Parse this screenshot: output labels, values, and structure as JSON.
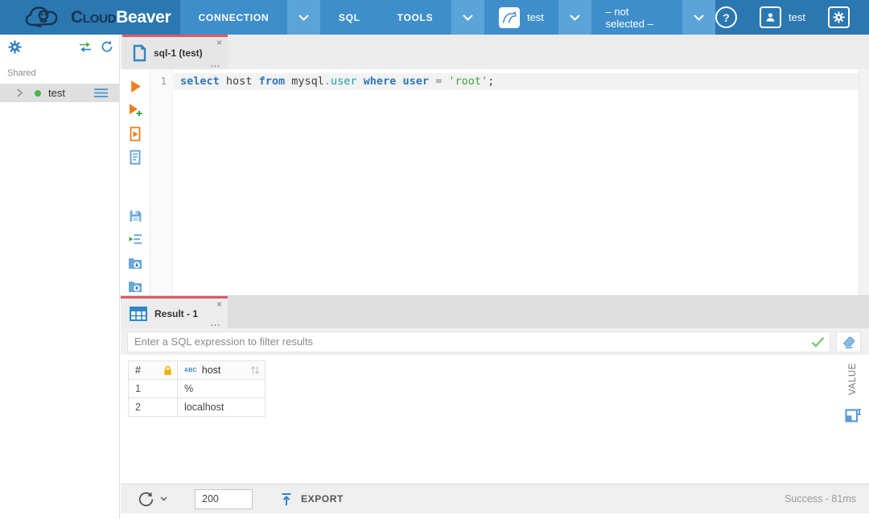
{
  "topbar": {
    "brand": {
      "bold": "Cloud",
      "light": "Beaver"
    },
    "menu": {
      "connection": "CONNECTION",
      "sql": "SQL",
      "tools": "TOOLS"
    },
    "connection_name": "test",
    "database_selector": "– not selected –",
    "user_name": "test"
  },
  "icons": {
    "help_glyph": "?",
    "close_glyph": "×",
    "menu_dots_glyph": "..."
  },
  "sidebar": {
    "shared_label": "Shared",
    "tree_item": {
      "label": "test"
    }
  },
  "editor": {
    "tab_title": "sql-1 (test)",
    "line_number": "1",
    "tokens": [
      {
        "text": "select",
        "cls": "tok kw"
      },
      {
        "text": " host ",
        "cls": "tok plain"
      },
      {
        "text": "from",
        "cls": "tok kw"
      },
      {
        "text": " mysql",
        "cls": "tok plain"
      },
      {
        "text": ".",
        "cls": "tok dot"
      },
      {
        "text": "user",
        "cls": "tok type"
      },
      {
        "text": " ",
        "cls": "tok plain"
      },
      {
        "text": "where",
        "cls": "tok kw"
      },
      {
        "text": " ",
        "cls": "tok plain"
      },
      {
        "text": "user",
        "cls": "tok kw"
      },
      {
        "text": " ",
        "cls": "tok plain"
      },
      {
        "text": "=",
        "cls": "tok op"
      },
      {
        "text": " ",
        "cls": "tok plain"
      },
      {
        "text": "'root'",
        "cls": "tok str"
      },
      {
        "text": ";",
        "cls": "tok plain"
      }
    ]
  },
  "result": {
    "tab_title": "Result - 1",
    "filter_placeholder": "Enter a SQL expression to filter results",
    "grid": {
      "index_header": "#",
      "column": {
        "type_badge": "ABC",
        "name": "host"
      },
      "rows": [
        {
          "index": "1",
          "value": "%"
        },
        {
          "index": "2",
          "value": "localhost"
        }
      ]
    },
    "value_panel_label": "VALUE",
    "footer": {
      "row_limit": "200",
      "export_label": "EXPORT",
      "status": "Success - 81ms"
    }
  },
  "colors": {
    "topbar_dark": "#2b77b1",
    "topbar_medium": "#3e8ecb",
    "topbar_light": "#5ba4d8",
    "active_tab_border": "#e25767",
    "connected_dot": "#4db04d",
    "action_orange": "#ed7d23",
    "action_blue": "#6aa7dd",
    "keyword_blue": "#2e77b8",
    "type_teal": "#18a0a8",
    "string_green": "#3aa63a"
  }
}
